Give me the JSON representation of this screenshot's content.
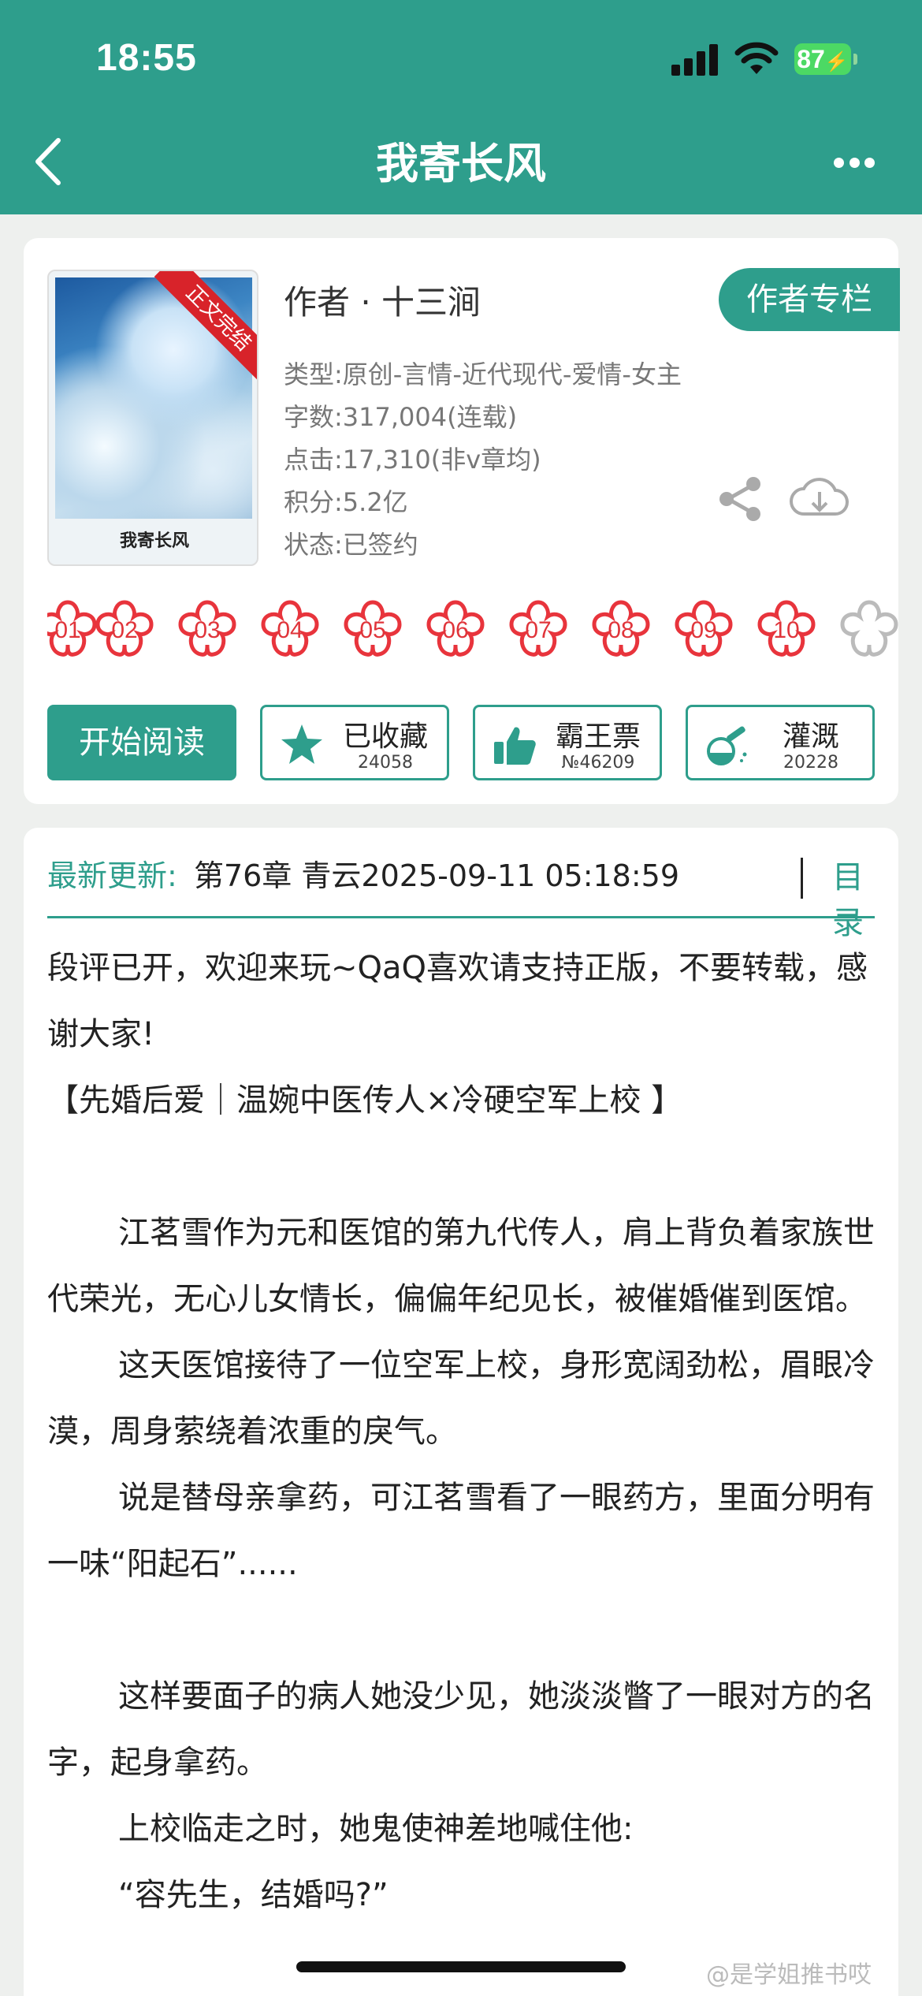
{
  "status_bar": {
    "time": "18:55",
    "battery": "87"
  },
  "nav": {
    "title": "我寄长风"
  },
  "book": {
    "cover_title": "我寄长风",
    "cover_ribbon": "正文完结",
    "author": "作者 · 十三涧",
    "author_button": "作者专栏",
    "type": "类型:原创-言情-近代现代-爱情-女主",
    "words": "字数:317,004(连载)",
    "clicks": "点击:17,310(非v章均)",
    "score": "积分:5.2亿",
    "status": "状态:已签约"
  },
  "flowers": [
    "01",
    "02",
    "03",
    "04",
    "05",
    "06",
    "07",
    "08",
    "09",
    "10"
  ],
  "actions": {
    "read": "开始阅读",
    "collect": {
      "label": "已收藏",
      "sub": "24058"
    },
    "vote": {
      "label": "霸王票",
      "sub": "№46209"
    },
    "water": {
      "label": "灌溉",
      "sub": "20228"
    }
  },
  "update": {
    "label": "最新更新:",
    "text": "第76章 青云2025-09-11 05:18:59",
    "toc": "目录"
  },
  "description": [
    "段评已开，欢迎来玩~QaQ喜欢请支持正版，不要转载，感谢大家!",
    "【先婚后爱｜温婉中医传人×冷硬空军上校 】",
    "",
    "江茗雪作为元和医馆的第九代传人，肩上背负着家族世代荣光，无心儿女情长，偏偏年纪见长，被催婚催到医馆。",
    "这天医馆接待了一位空军上校，身形宽阔劲松，眉眼冷漠，周身萦绕着浓重的戾气。",
    "说是替母亲拿药，可江茗雪看了一眼药方，里面分明有一味“阳起石”......",
    "",
    "这样要面子的病人她没少见，她淡淡瞥了一眼对方的名字，起身拿药。",
    "上校临走之时，她鬼使神差地喊住他:",
    "“容先生，结婚吗?”"
  ],
  "watermark": "@是学姐推书哎"
}
